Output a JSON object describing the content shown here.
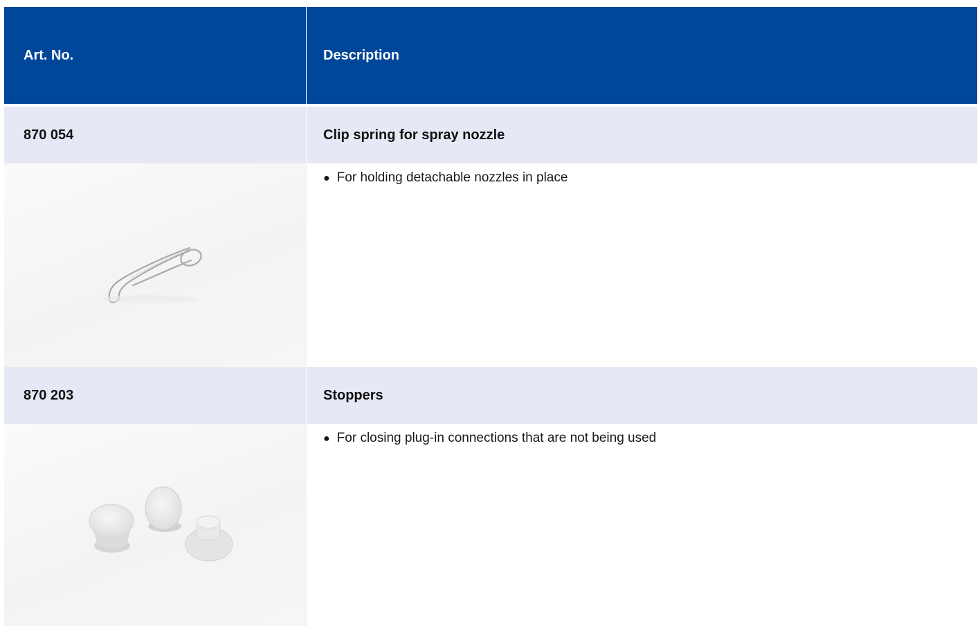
{
  "header": {
    "col1": "Art. No.",
    "col2": "Description"
  },
  "items": [
    {
      "art_no": "870 054",
      "title": "Clip spring for spray nozzle",
      "bullet": "For holding detachable nozzles in place",
      "image_icon": "clip-spring-icon"
    },
    {
      "art_no": "870 203",
      "title": "Stoppers",
      "bullet": "For closing plug-in connections that are not being used",
      "image_icon": "stoppers-icon"
    }
  ],
  "colors": {
    "header_bg": "#004799",
    "title_row_bg": "#e6e8f5"
  }
}
